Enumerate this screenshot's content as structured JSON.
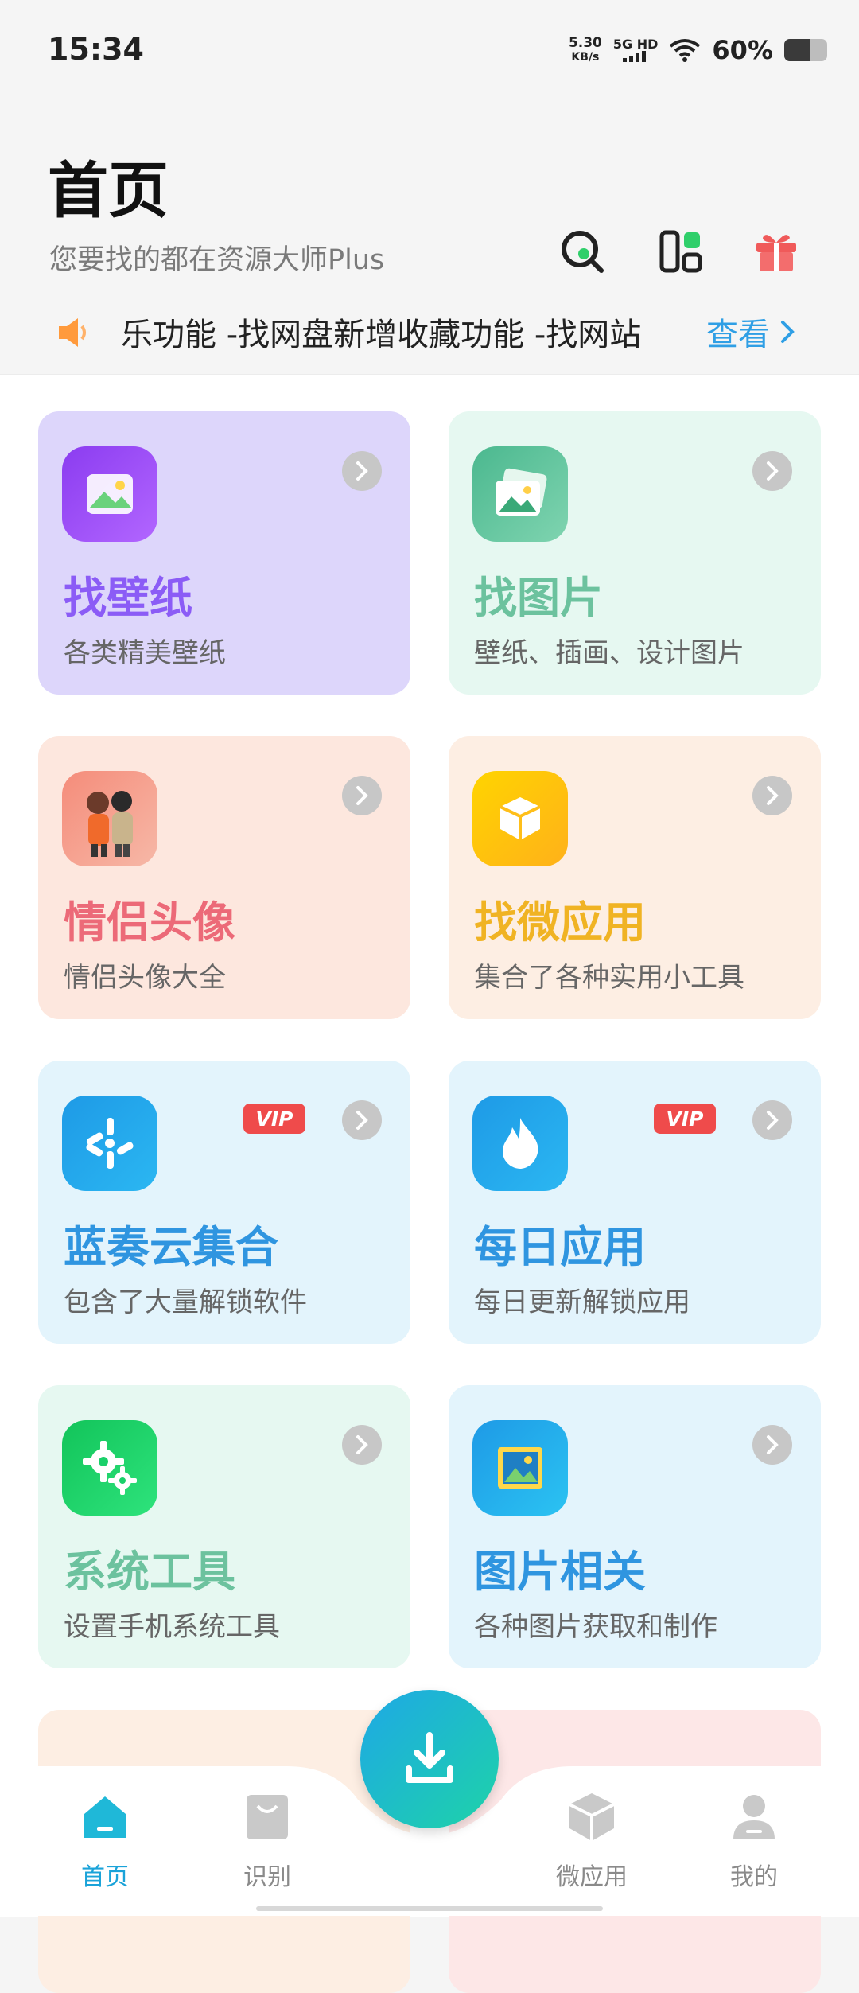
{
  "status": {
    "time": "15:34",
    "net_speed_value": "5.30",
    "net_speed_unit": "KB/s",
    "network": "5G HD",
    "battery_text": "60%",
    "battery_level": 0.6
  },
  "header": {
    "title": "首页",
    "subtitle": "您要找的都在资源大师Plus",
    "icons": [
      "search-icon",
      "dashboard-icon",
      "gift-icon"
    ]
  },
  "notice": {
    "text": "乐功能 -找网盘新增收藏功能 -找网站",
    "more_label": "查看"
  },
  "cards": [
    {
      "name": "找壁纸",
      "desc": "各类精美壁纸",
      "color": "#8b5cf6",
      "bg": "#ddd6fb",
      "icon": "wallpaper-icon",
      "vip": false
    },
    {
      "name": "找图片",
      "desc": "壁纸、插画、设计图片",
      "color": "#6cc29e",
      "bg": "#e6f8f1",
      "icon": "picture-icon",
      "vip": false
    },
    {
      "name": "情侣头像",
      "desc": "情侣头像大全",
      "color": "#ec6a78",
      "bg": "#fde7de",
      "icon": "couple-avatar-icon",
      "vip": false
    },
    {
      "name": "找微应用",
      "desc": "集合了各种实用小工具",
      "color": "#f0b323",
      "bg": "#fdeee3",
      "icon": "box-icon",
      "vip": false
    },
    {
      "name": "蓝奏云集合",
      "desc": "包含了大量解锁软件",
      "color": "#2f95e0",
      "bg": "#e3f4fc",
      "icon": "cloud-collection-icon",
      "vip": true,
      "vip_label": "VIP"
    },
    {
      "name": "每日应用",
      "desc": "每日更新解锁应用",
      "color": "#2f95e0",
      "bg": "#e3f4fc",
      "icon": "flame-icon",
      "vip": true,
      "vip_label": "VIP"
    },
    {
      "name": "系统工具",
      "desc": "设置手机系统工具",
      "color": "#6cc29e",
      "bg": "#e6f8f1",
      "icon": "gear-icon",
      "vip": false
    },
    {
      "name": "图片相关",
      "desc": "各种图片获取和制作",
      "color": "#2f95e0",
      "bg": "#e3f4fc",
      "icon": "image-icon",
      "vip": false
    }
  ],
  "nav": {
    "items": [
      {
        "label": "首页",
        "active": true,
        "icon": "home-icon"
      },
      {
        "label": "识别",
        "active": false,
        "icon": "bag-icon"
      },
      {
        "label": "微应用",
        "active": false,
        "icon": "cube-icon"
      },
      {
        "label": "我的",
        "active": false,
        "icon": "profile-icon"
      }
    ],
    "active_color": "#1aa3d9",
    "inactive_color": "#8a8a8a"
  }
}
